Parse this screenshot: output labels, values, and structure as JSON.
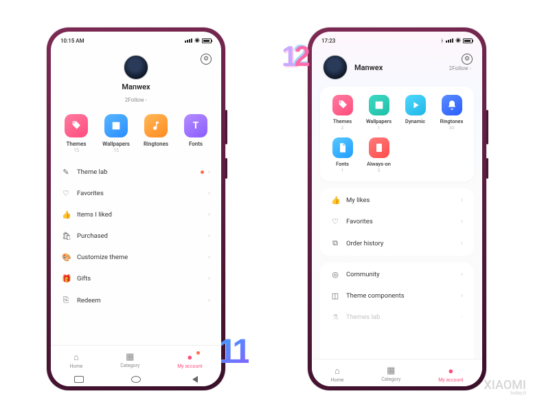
{
  "miui11": {
    "status": {
      "time": "10:15 AM"
    },
    "user": {
      "name": "Manwex",
      "follow": "2Follow"
    },
    "tiles": [
      {
        "label": "Themes",
        "count": "15",
        "color": "pink",
        "glyph": "tag"
      },
      {
        "label": "Wallpapers",
        "count": "15",
        "color": "blue",
        "glyph": "image"
      },
      {
        "label": "Ringtones",
        "count": "",
        "color": "orange",
        "glyph": "note"
      },
      {
        "label": "Fonts",
        "count": "",
        "color": "purple",
        "glyph": "T"
      }
    ],
    "rows": [
      {
        "icon": "✎",
        "label": "Theme lab",
        "dot": true
      },
      {
        "icon": "♡",
        "label": "Favorites",
        "dot": false
      },
      {
        "icon": "👍",
        "label": "Items I liked",
        "dot": false
      },
      {
        "icon": "🛍",
        "label": "Purchased",
        "dot": false
      },
      {
        "icon": "🎨",
        "label": "Customize theme",
        "dot": false
      },
      {
        "icon": "🎁",
        "label": "Gifts",
        "dot": false
      },
      {
        "icon": "⎘",
        "label": "Redeem",
        "dot": false
      }
    ],
    "nav": [
      {
        "label": "Home",
        "active": false,
        "dot": false
      },
      {
        "label": "Category",
        "active": false,
        "dot": false
      },
      {
        "label": "My account",
        "active": true,
        "dot": true
      }
    ]
  },
  "miui12": {
    "status": {
      "time": "17:23"
    },
    "user": {
      "name": "Manwex",
      "follow": "2Follow"
    },
    "tiles": [
      {
        "label": "Themes",
        "count": "2",
        "color": "pink",
        "glyph": "tag"
      },
      {
        "label": "Wallpapers",
        "count": "1",
        "color": "teal",
        "glyph": "image"
      },
      {
        "label": "Dynamic",
        "count": "",
        "color": "cyan",
        "glyph": "play"
      },
      {
        "label": "Ringtones",
        "count": "33",
        "color": "dblue",
        "glyph": "bell"
      },
      {
        "label": "Fonts",
        "count": "1",
        "color": "sblue",
        "glyph": "file"
      },
      {
        "label": "Always-on",
        "count": "5",
        "color": "red",
        "glyph": "aod"
      }
    ],
    "rows_top": [
      {
        "icon": "👍",
        "label": "My likes"
      },
      {
        "icon": "♡",
        "label": "Favorites"
      },
      {
        "icon": "⧉",
        "label": "Order history"
      }
    ],
    "rows_bot": [
      {
        "icon": "◎",
        "label": "Community"
      },
      {
        "icon": "◫",
        "label": "Theme components"
      },
      {
        "icon": "⚗",
        "label": "Themes lab"
      }
    ],
    "nav": [
      {
        "label": "Home",
        "active": false
      },
      {
        "label": "Category",
        "active": false
      },
      {
        "label": "My account",
        "active": true
      }
    ]
  },
  "badges": {
    "v11": "11",
    "v12_1": "1",
    "v12_2": "2"
  },
  "watermark": {
    "brand": "XIAOMI",
    "site": "today.it"
  }
}
